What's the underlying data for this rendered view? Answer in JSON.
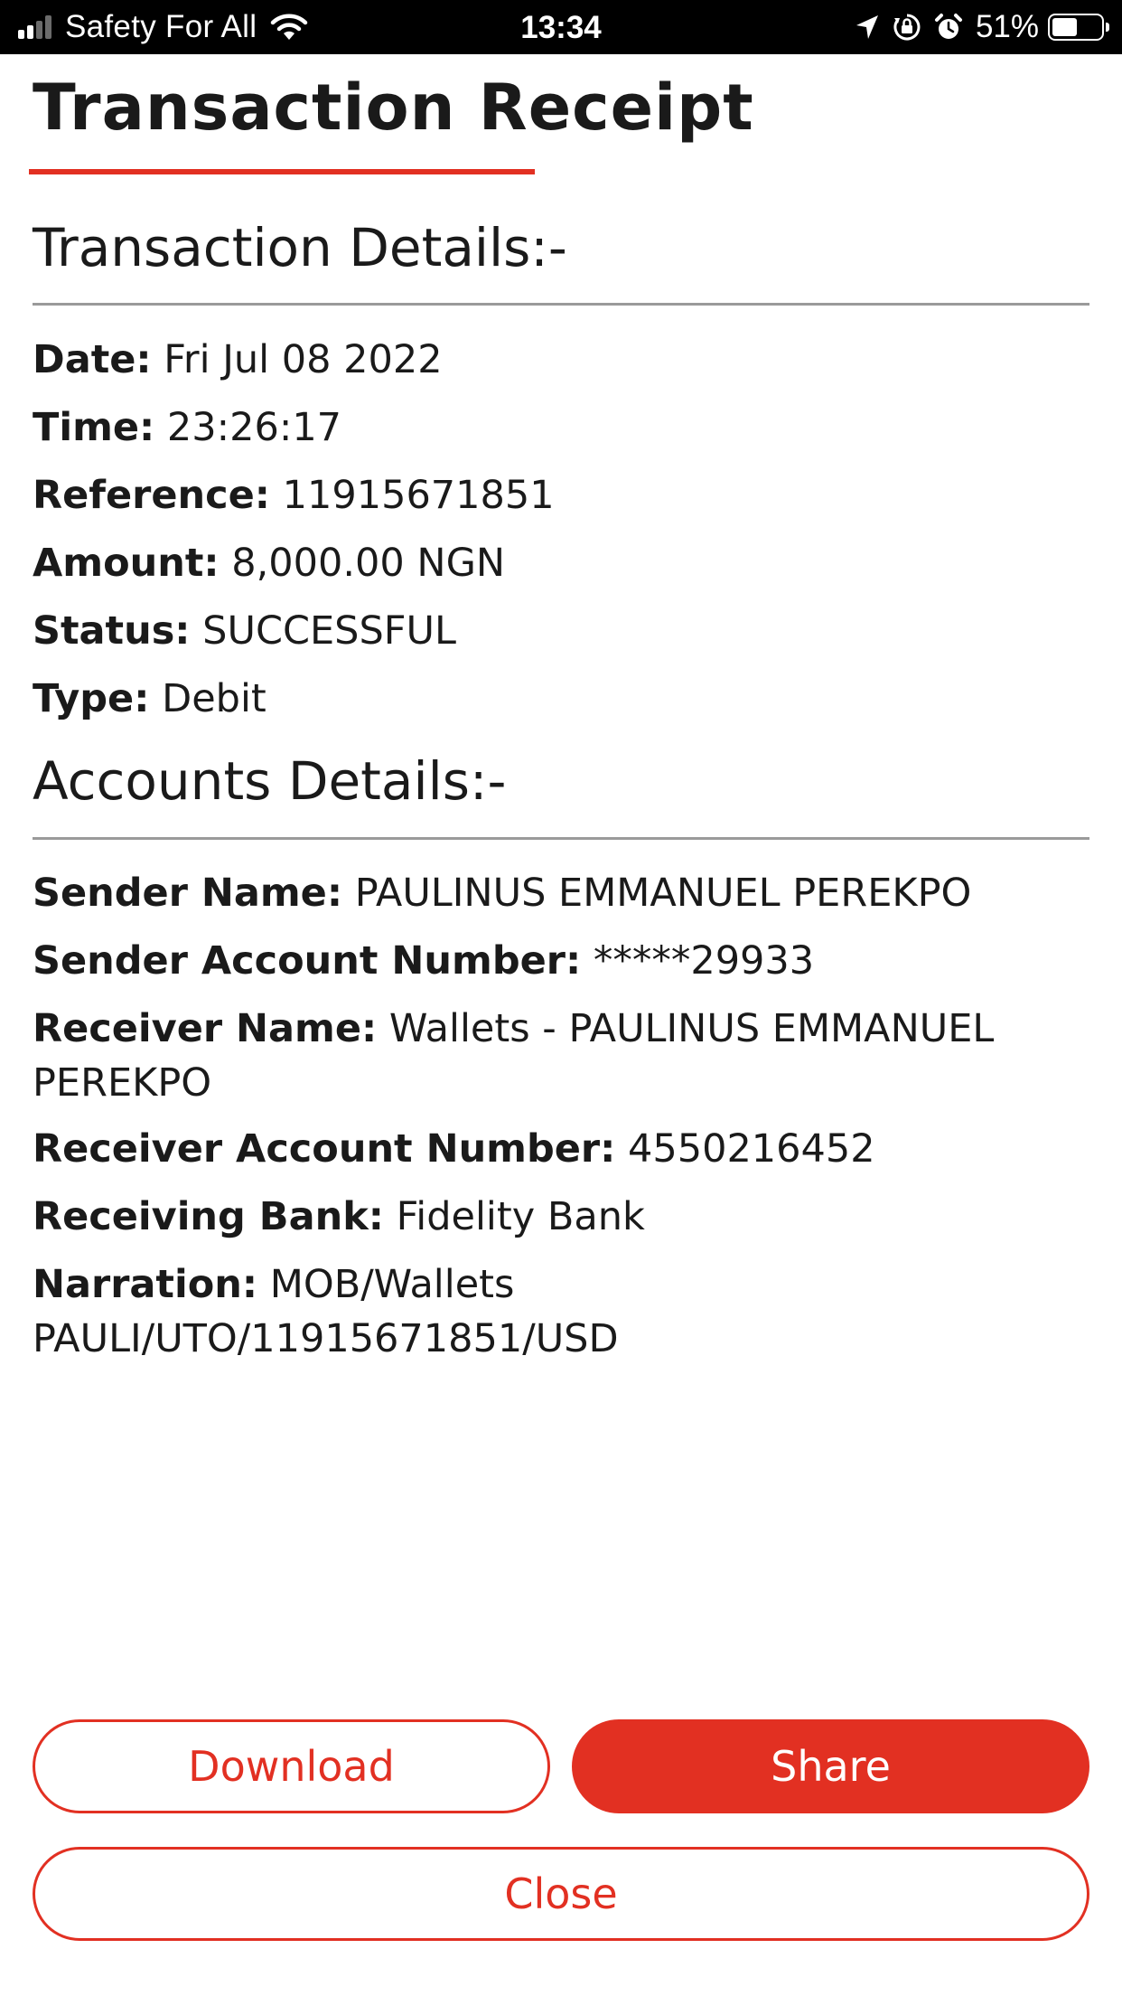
{
  "status_bar": {
    "carrier": "Safety For All",
    "time": "13:34",
    "battery_percent": "51%",
    "battery_level": 0.51,
    "signal_bars_active": 2,
    "signal_bars_total": 4
  },
  "header": {
    "title": "Transaction Receipt",
    "accent_color": "#e23022"
  },
  "transaction_details": {
    "heading": "Transaction Details:-",
    "rows": [
      {
        "label": "Date:",
        "value": "Fri Jul 08 2022"
      },
      {
        "label": "Time:",
        "value": "23:26:17"
      },
      {
        "label": "Reference:",
        "value": "11915671851"
      },
      {
        "label": "Amount:",
        "value": "8,000.00 NGN"
      },
      {
        "label": "Status:",
        "value": "SUCCESSFUL"
      },
      {
        "label": "Type:",
        "value": "Debit"
      }
    ]
  },
  "account_details": {
    "heading": "Accounts Details:-",
    "rows": [
      {
        "label": "Sender Name:",
        "value": "PAULINUS EMMANUEL PEREKPO"
      },
      {
        "label": "Sender Account Number:",
        "value": "*****29933"
      },
      {
        "label": "Receiver Name:",
        "value": "Wallets - PAULINUS EMMANUEL PEREKPO"
      },
      {
        "label": "Receiver Account Number:",
        "value": "4550216452"
      },
      {
        "label": "Receiving Bank:",
        "value": "Fidelity Bank"
      },
      {
        "label": "Narration:",
        "value": "MOB/Wallets PAULI/UTO/11915671851/USD"
      }
    ]
  },
  "actions": {
    "download_label": "Download",
    "share_label": "Share",
    "close_label": "Close"
  },
  "icons": {
    "wifi": "wifi-icon",
    "location": "location-arrow-icon",
    "orientation_lock": "orientation-lock-icon",
    "alarm": "alarm-clock-icon",
    "battery": "battery-icon",
    "signal": "cellular-signal-icon"
  }
}
